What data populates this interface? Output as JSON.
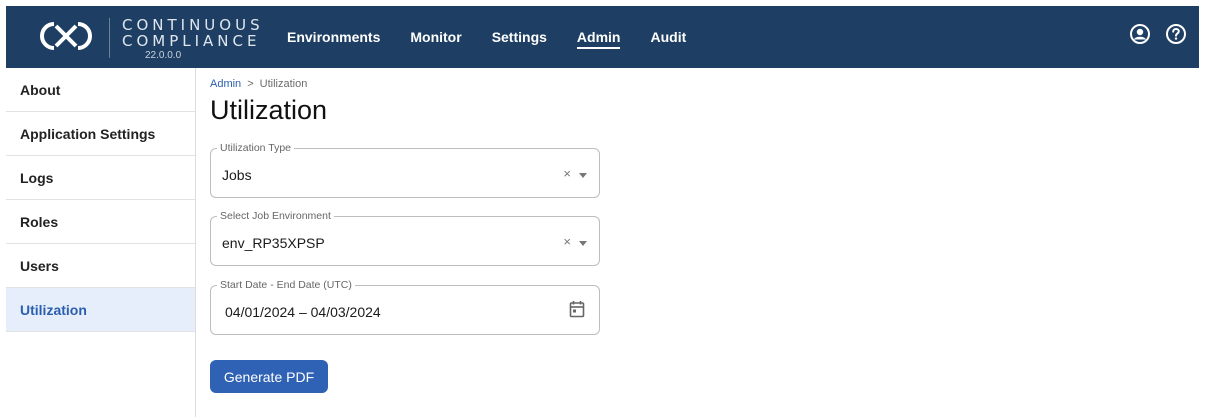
{
  "brand": {
    "line1": "CONTINUOUS",
    "line2": "COMPLIANCE",
    "version": "22.0.0.0"
  },
  "nav": {
    "items": [
      {
        "label": "Environments",
        "active": false
      },
      {
        "label": "Monitor",
        "active": false
      },
      {
        "label": "Settings",
        "active": false
      },
      {
        "label": "Admin",
        "active": true
      },
      {
        "label": "Audit",
        "active": false
      }
    ]
  },
  "header_icons": [
    "account-icon",
    "help-icon"
  ],
  "sidebar": {
    "items": [
      {
        "label": "About"
      },
      {
        "label": "Application Settings"
      },
      {
        "label": "Logs"
      },
      {
        "label": "Roles"
      },
      {
        "label": "Users"
      },
      {
        "label": "Utilization",
        "active": true
      }
    ]
  },
  "breadcrumb": {
    "parent": "Admin",
    "separator": ">",
    "current": "Utilization"
  },
  "page": {
    "title": "Utilization"
  },
  "form": {
    "utilization_type": {
      "label": "Utilization Type",
      "value": "Jobs",
      "clear": "×"
    },
    "job_environment": {
      "label": "Select Job Environment",
      "value": "env_RP35XPSP",
      "clear": "×"
    },
    "date_range": {
      "label": "Start Date - End Date (UTC)",
      "value": "04/01/2024 – 04/03/2024"
    },
    "generate_label": "Generate PDF"
  },
  "colors": {
    "header_bg": "#1e3f63",
    "accent": "#2f62b4",
    "sidebar_active_bg": "#e6eefb"
  }
}
